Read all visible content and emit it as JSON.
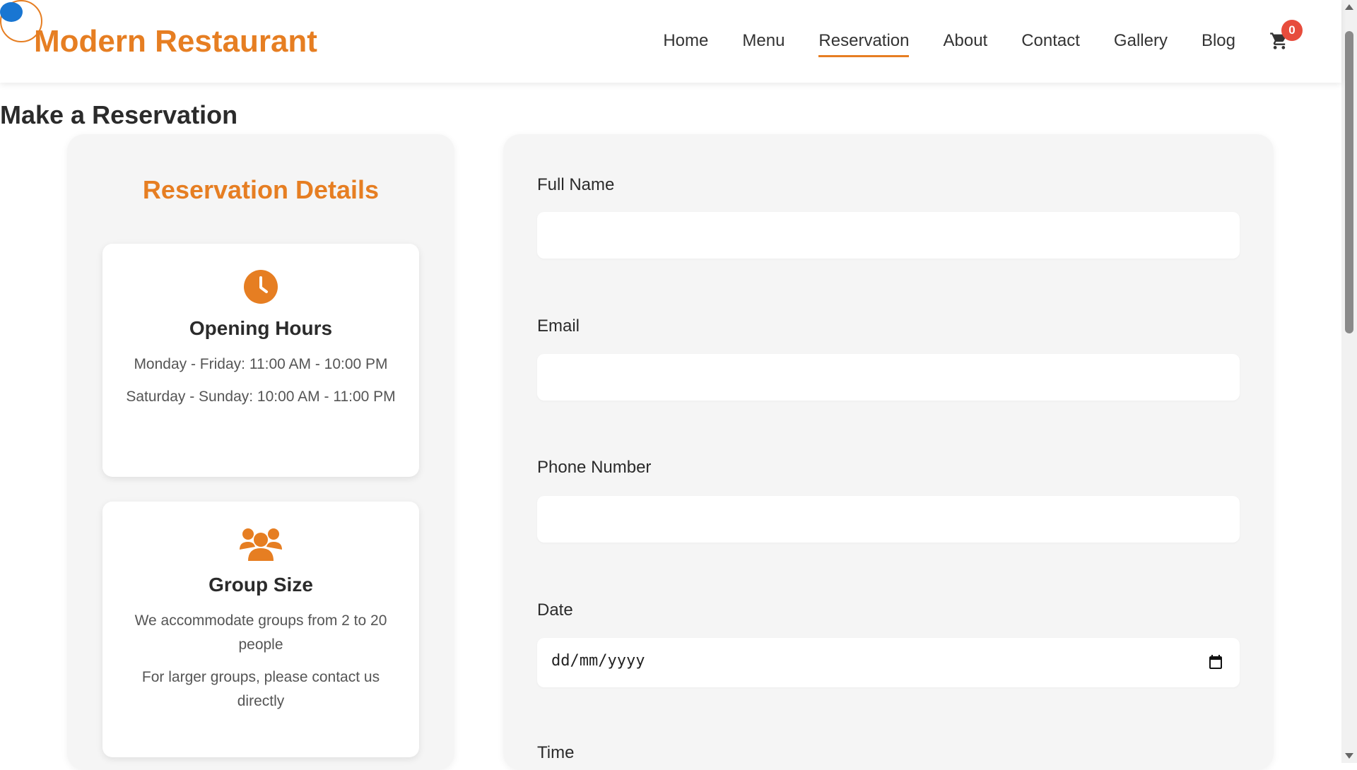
{
  "header": {
    "logo_text": "Modern Restaurant",
    "nav": [
      {
        "label": "Home",
        "active": false
      },
      {
        "label": "Menu",
        "active": false
      },
      {
        "label": "Reservation",
        "active": true
      },
      {
        "label": "About",
        "active": false
      },
      {
        "label": "Contact",
        "active": false
      },
      {
        "label": "Gallery",
        "active": false
      },
      {
        "label": "Blog",
        "active": false
      }
    ],
    "cart_count": "0",
    "cart_icon": "shopping-cart-icon"
  },
  "page": {
    "title": "Make a Reservation"
  },
  "details": {
    "title": "Reservation Details",
    "cards": [
      {
        "icon": "clock-icon",
        "title": "Opening Hours",
        "lines": [
          "Monday - Friday: 11:00 AM - 10:00 PM",
          "Saturday - Sunday: 10:00 AM - 11:00 PM"
        ]
      },
      {
        "icon": "users-group-icon",
        "title": "Group Size",
        "lines": [
          "We accommodate groups from 2 to 20 people",
          "For larger groups, please contact us directly"
        ]
      }
    ]
  },
  "form": {
    "full_name": {
      "label": "Full Name",
      "value": ""
    },
    "email": {
      "label": "Email",
      "value": ""
    },
    "phone": {
      "label": "Phone Number",
      "value": ""
    },
    "date": {
      "label": "Date",
      "placeholder": "dd/mm/yyyy",
      "icon": "calendar-icon"
    },
    "time": {
      "label": "Time"
    }
  },
  "colors": {
    "accent": "#e67e22",
    "badge": "#e74c3c",
    "panel": "#f5f5f5",
    "text_dark": "#2b2b2b"
  }
}
